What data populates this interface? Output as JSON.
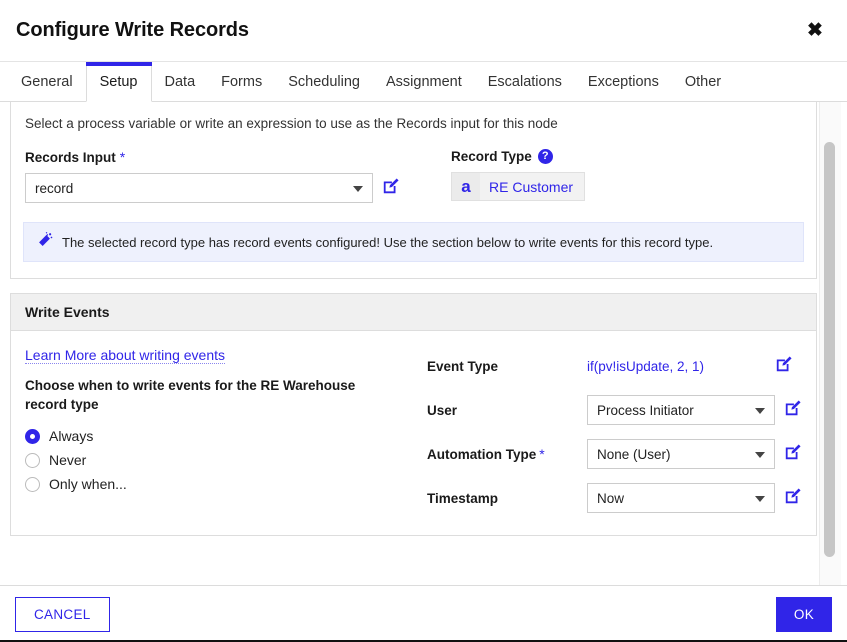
{
  "dialog": {
    "title": "Configure Write Records",
    "close_label": "✖",
    "close_icon": "close-icon"
  },
  "tabs": [
    {
      "label": "General",
      "active": false
    },
    {
      "label": "Setup",
      "active": true
    },
    {
      "label": "Data",
      "active": false
    },
    {
      "label": "Forms",
      "active": false
    },
    {
      "label": "Scheduling",
      "active": false
    },
    {
      "label": "Assignment",
      "active": false
    },
    {
      "label": "Escalations",
      "active": false
    },
    {
      "label": "Exceptions",
      "active": false
    },
    {
      "label": "Other",
      "active": false
    }
  ],
  "setup": {
    "hint": "Select a process variable or write an expression to use as the Records input for this node",
    "records_input": {
      "label": "Records Input",
      "required_mark": "*",
      "value": "record",
      "edit_icon": "edit-expression-icon"
    },
    "record_type": {
      "label": "Record Type",
      "help_icon": "help-icon",
      "help_glyph": "?",
      "chip_glyph": "a",
      "value": "RE Customer"
    },
    "banner": {
      "icon": "magic-wand-icon",
      "text": "The selected record type has record events configured! Use the section below to write events for this record type."
    }
  },
  "write_events": {
    "section_title": "Write Events",
    "learn_more_link": "Learn More about writing events",
    "choose_text": "Choose when to write events for the RE Warehouse record type",
    "options": [
      {
        "label": "Always",
        "selected": true
      },
      {
        "label": "Never",
        "selected": false
      },
      {
        "label": "Only when...",
        "selected": false
      }
    ],
    "fields": [
      {
        "label": "Event Type",
        "required_mark": "",
        "value": "if(pv!isUpdate, 2, 1)",
        "kind": "expression",
        "edit_icon": "edit-expression-icon"
      },
      {
        "label": "User",
        "required_mark": "",
        "value": "Process Initiator",
        "kind": "select",
        "edit_icon": "edit-expression-icon"
      },
      {
        "label": "Automation Type",
        "required_mark": "*",
        "value": "None (User)",
        "kind": "select",
        "edit_icon": "edit-expression-icon"
      },
      {
        "label": "Timestamp",
        "required_mark": "",
        "value": "Now",
        "kind": "select",
        "edit_icon": "edit-expression-icon"
      }
    ]
  },
  "footer": {
    "cancel_label": "CANCEL",
    "ok_label": "OK"
  },
  "colors": {
    "accent": "#3025e8",
    "banner_bg": "#eef1fd",
    "section_head_bg": "#f0f0f0"
  }
}
